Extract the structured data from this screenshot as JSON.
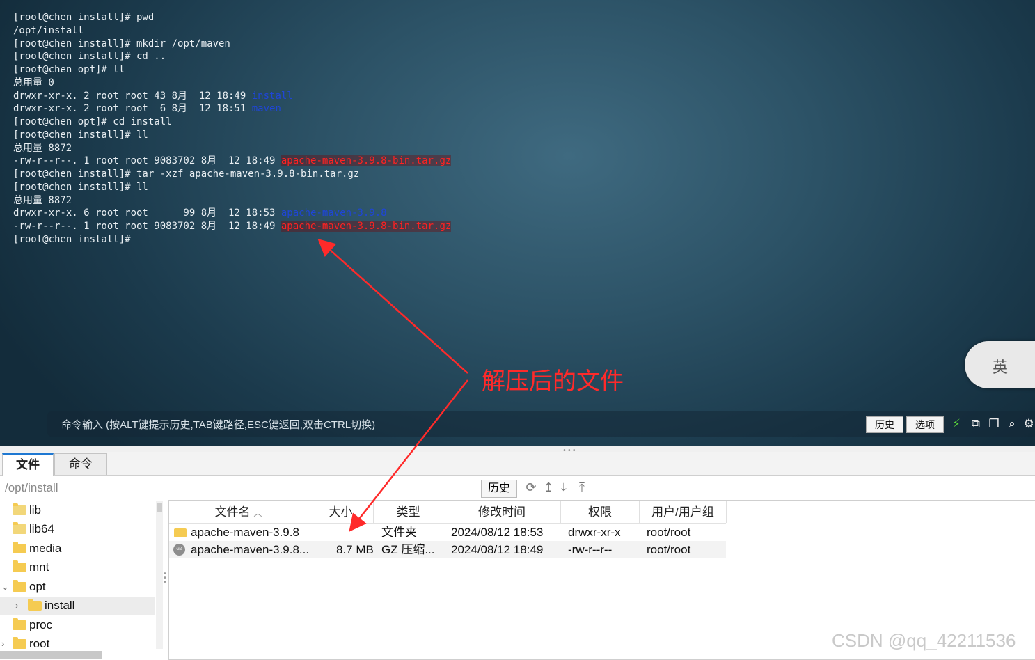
{
  "terminal": {
    "lines": [
      [
        {
          "t": "[root@chen install]# pwd"
        }
      ],
      [
        {
          "t": "/opt/install"
        }
      ],
      [
        {
          "t": "[root@chen install]# mkdir /opt/maven"
        }
      ],
      [
        {
          "t": "[root@chen install]# cd .."
        }
      ],
      [
        {
          "t": "[root@chen opt]# ll"
        }
      ],
      [
        {
          "t": "总用量 0"
        }
      ],
      [
        {
          "t": "drwxr-xr-x. 2 root root 43 8月  12 18:49 "
        },
        {
          "t": "install",
          "c": "dir"
        }
      ],
      [
        {
          "t": "drwxr-xr-x. 2 root root  6 8月  12 18:51 "
        },
        {
          "t": "maven",
          "c": "dir"
        }
      ],
      [
        {
          "t": "[root@chen opt]# cd install"
        }
      ],
      [
        {
          "t": "[root@chen install]# ll"
        }
      ],
      [
        {
          "t": "总用量 8872"
        }
      ],
      [
        {
          "t": "-rw-r--r--. 1 root root 9083702 8月  12 18:49 "
        },
        {
          "t": "apache-maven-3.9.8-bin.tar.gz",
          "c": "gz"
        }
      ],
      [
        {
          "t": "[root@chen install]# tar -xzf apache-maven-3.9.8-bin.tar.gz"
        }
      ],
      [
        {
          "t": "[root@chen install]# ll"
        }
      ],
      [
        {
          "t": "总用量 8872"
        }
      ],
      [
        {
          "t": "drwxr-xr-x. 6 root root      99 8月  12 18:53 "
        },
        {
          "t": "apache-maven-3.9.8",
          "c": "dir"
        }
      ],
      [
        {
          "t": "-rw-r--r--. 1 root root 9083702 8月  12 18:49 "
        },
        {
          "t": "apache-maven-3.9.8-bin.tar.gz",
          "c": "gz"
        }
      ],
      [
        {
          "t": "[root@chen install]#"
        }
      ]
    ],
    "colors": {
      "dir": "#1f46d6",
      "gz": "#ff2222"
    }
  },
  "annotation": {
    "text": "解压后的文件",
    "color": "#ff2a2a"
  },
  "command_bar": {
    "hint": "命令输入 (按ALT键提示历史,TAB键路径,ESC键返回,双击CTRL切换)",
    "history_label": "历史",
    "options_label": "选项"
  },
  "ime": {
    "label": "英"
  },
  "tabs": [
    {
      "label": "文件",
      "active": true
    },
    {
      "label": "命令",
      "active": false
    }
  ],
  "path": {
    "current": "/opt/install",
    "history_label": "历史"
  },
  "tree": {
    "items": [
      {
        "label": "lib"
      },
      {
        "label": "lib64"
      },
      {
        "label": "media"
      },
      {
        "label": "mnt"
      },
      {
        "label": "opt"
      },
      {
        "label": "install"
      },
      {
        "label": "proc"
      },
      {
        "label": "root"
      }
    ]
  },
  "file_table": {
    "columns": [
      "文件名",
      "大小",
      "类型",
      "修改时间",
      "权限",
      "用户/用户组"
    ],
    "rows": [
      {
        "name": "apache-maven-3.9.8",
        "size": "",
        "type": "文件夹",
        "mtime": "2024/08/12 18:53",
        "perm": "drwxr-xr-x",
        "owner": "root/root"
      },
      {
        "name": "apache-maven-3.9.8...",
        "size": "8.7 MB",
        "type": "GZ 压缩...",
        "mtime": "2024/08/12 18:49",
        "perm": "-rw-r--r--",
        "owner": "root/root"
      }
    ]
  },
  "watermark": "CSDN @qq_42211536"
}
